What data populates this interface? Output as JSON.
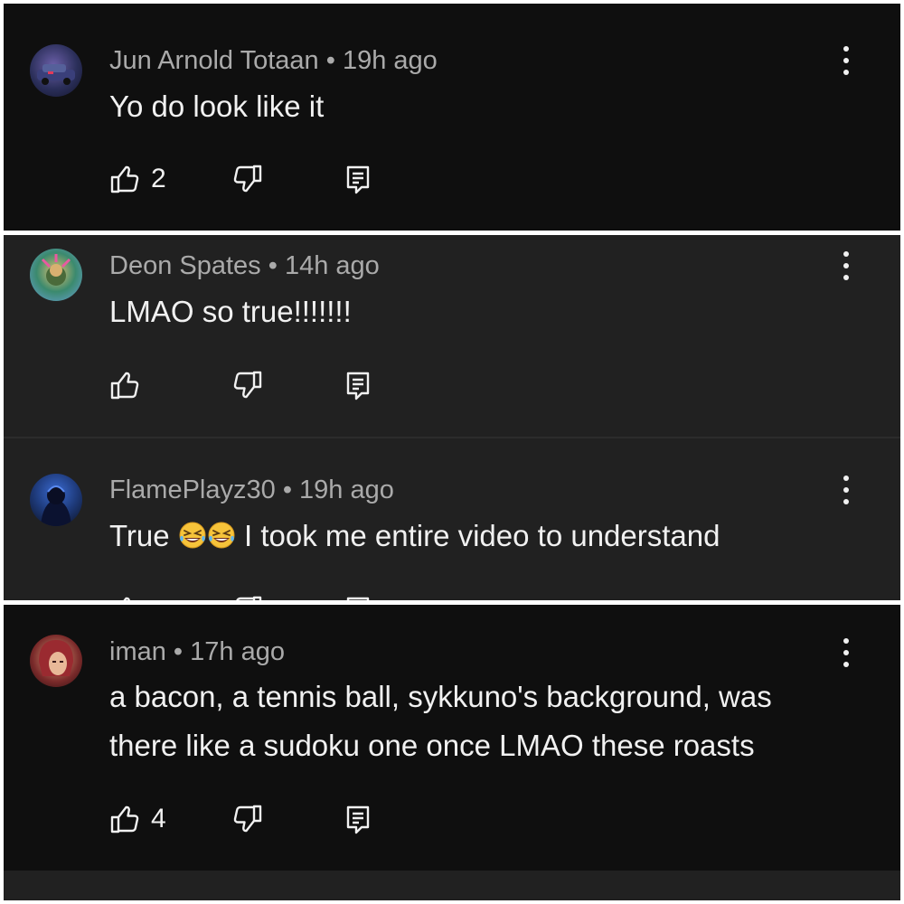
{
  "comments": [
    {
      "author": "Jun Arnold Totaan",
      "separator": "•",
      "time": "19h ago",
      "text": "Yo do look like it",
      "likes": "2",
      "avatar_colors": [
        "#2b2f5a",
        "#7a4a6a"
      ]
    },
    {
      "author": "Deon Spates",
      "separator": "•",
      "time": "14h ago",
      "text": "LMAO so true!!!!!!!",
      "likes": "",
      "avatar_colors": [
        "#3b8a6e",
        "#c9a24a"
      ]
    },
    {
      "author": "FlamePlayz30",
      "separator": "•",
      "time": "19h ago",
      "text_before": "True",
      "text_after": "I took me entire video to understand",
      "emoji": [
        "rolling-on-floor-laughing",
        "rolling-on-floor-laughing"
      ],
      "likes": "",
      "avatar_colors": [
        "#1e3a7a",
        "#0b0f1e"
      ]
    },
    {
      "author": "iman",
      "separator": "•",
      "time": "17h ago",
      "text_line1": "a bacon, a tennis ball, sykkuno's background, was",
      "text_line2": "there like a sudoku one once LMAO these roasts",
      "likes": "4",
      "avatar_colors": [
        "#7a2a2a",
        "#d9a07a"
      ]
    }
  ],
  "icons": {
    "like": "thumbs-up-icon",
    "dislike": "thumbs-down-icon",
    "reply": "reply-icon",
    "more": "more-vertical-icon"
  },
  "colors": {
    "dark_panel": "#0f0f0f",
    "highlight_panel": "#212121",
    "primary_text": "#f1f1f1",
    "secondary_text": "#aaaaaa"
  }
}
